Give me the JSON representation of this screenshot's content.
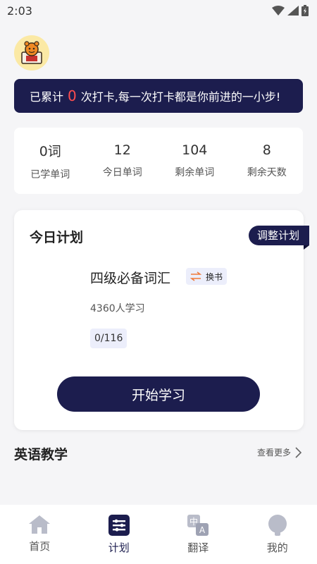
{
  "status_bar": {
    "time": "2:03",
    "icons": [
      "wifi-icon",
      "signal-icon",
      "battery-icon"
    ]
  },
  "banner": {
    "prefix": "已累计",
    "count": "0",
    "suffix": "次打卡,每一次打卡都是你前进的一小步!"
  },
  "stats": [
    {
      "value": "0词",
      "label": "已学单词"
    },
    {
      "value": "12",
      "label": "今日单词"
    },
    {
      "value": "104",
      "label": "剩余单词"
    },
    {
      "value": "8",
      "label": "剩余天数"
    }
  ],
  "plan": {
    "title": "今日计划",
    "adjust_label": "调整计划",
    "book_name": "四级必备词汇",
    "swap_label": "换书",
    "learners": "4360人学习",
    "progress": "0/116",
    "start_label": "开始学习"
  },
  "section": {
    "title": "英语教学",
    "more_label": "查看更多"
  },
  "tabbar": {
    "items": [
      {
        "label": "首页",
        "icon": "home-icon"
      },
      {
        "label": "计划",
        "icon": "plan-icon",
        "active": true
      },
      {
        "label": "翻译",
        "icon": "translate-icon"
      },
      {
        "label": "我的",
        "icon": "profile-icon"
      }
    ]
  },
  "colors": {
    "primary": "#1c1d4e",
    "accent_red": "#ff4d4f",
    "swap_orange": "#f07a3a",
    "background": "#f5f5f7"
  }
}
